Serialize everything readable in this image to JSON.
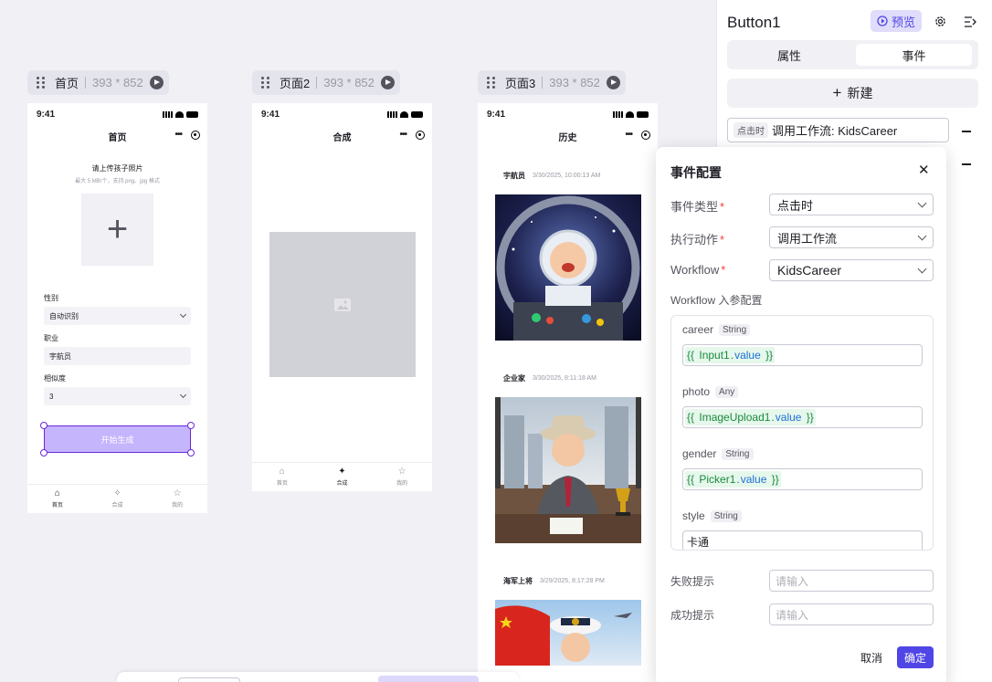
{
  "canvas": {
    "frames": [
      {
        "name": "首页",
        "size": "393 * 852"
      },
      {
        "name": "页面2",
        "size": "393 * 852"
      },
      {
        "name": "页面3",
        "size": "393 * 852"
      }
    ]
  },
  "phone_status_time": "9:41",
  "page1": {
    "title": "首页",
    "upload_title": "请上传孩子照片",
    "upload_hint": "最大 5 MB/个，支持 png、jpg 格式",
    "upload_plus": "+",
    "gender_label": "性别",
    "gender_value": "自动识别",
    "job_label": "职业",
    "job_value": "宇航员",
    "similarity_label": "相似度",
    "similarity_value": "3",
    "generate_button": "开始生成"
  },
  "page2": {
    "title": "合成"
  },
  "page3": {
    "title": "历史",
    "items": [
      {
        "title": "宇航员",
        "time": "3/30/2025, 10:00:13 AM"
      },
      {
        "title": "企业家",
        "time": "3/30/2025, 8:11:18 AM"
      },
      {
        "title": "海军上将",
        "time": "3/29/2025, 8:17:28 PM"
      }
    ]
  },
  "tabbar": [
    {
      "label": "首页",
      "icon": "home-icon"
    },
    {
      "label": "合成",
      "icon": "magic-icon"
    },
    {
      "label": "我的",
      "icon": "star-icon"
    }
  ],
  "panel": {
    "component_name": "Button1",
    "preview_label": "预览",
    "tabs": [
      "属性",
      "事件"
    ],
    "active_tab": "事件",
    "new_label": "新建",
    "event_tag": "点击时",
    "event_text": "调用工作流: KidsCareer"
  },
  "dialog": {
    "title": "事件配置",
    "event_type_label": "事件类型",
    "event_type_value": "点击时",
    "action_label": "执行动作",
    "action_value": "调用工作流",
    "workflow_label": "Workflow",
    "workflow_value": "KidsCareer",
    "params_title": "Workflow 入参配置",
    "params": [
      {
        "name": "career",
        "type": "String",
        "comp": "Input1",
        "prop": "value"
      },
      {
        "name": "photo",
        "type": "Any",
        "comp": "ImageUpload1",
        "prop": "value"
      },
      {
        "name": "gender",
        "type": "String",
        "comp": "Picker1",
        "prop": "value"
      },
      {
        "name": "style",
        "type": "String",
        "text": "卡通"
      }
    ],
    "fail_label": "失败提示",
    "fail_placeholder": "请输入",
    "success_label": "成功提示",
    "success_placeholder": "请输入",
    "cancel_label": "取消",
    "confirm_label": "确定",
    "brace_open": "{{",
    "brace_close": "}}"
  },
  "colors": {
    "accent": "#4f46e5",
    "selected_button": "#c4b5fd"
  }
}
